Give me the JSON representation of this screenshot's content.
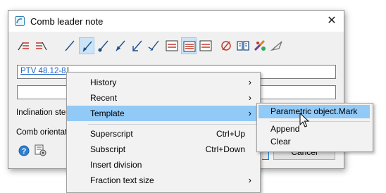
{
  "dialog": {
    "title": "Comb leader note",
    "field1_value": "PTV 48.12-8",
    "label_inclination": "Inclination step",
    "label_orientation": "Comb orientation",
    "cancel_label": "Cancel"
  },
  "toolbar": {
    "icons": [
      "leader-left-icon",
      "leader-right-icon",
      "line-plain-icon",
      "line-arrow-selected-icon",
      "line-dot-icon",
      "line-arrow-icon",
      "line-arrow-open-icon",
      "line-tick-icon",
      "align-left-icon",
      "align-center-icon",
      "align-right-icon",
      "clear-icon",
      "book-icon",
      "color-brush-icon",
      "pick-style-icon"
    ]
  },
  "context_menu": {
    "items": [
      {
        "label": "History",
        "submenu": true
      },
      {
        "label": "Recent",
        "submenu": true
      },
      {
        "label": "Template",
        "submenu": true,
        "highlighted": true
      },
      {
        "label": "Superscript",
        "shortcut": "Ctrl+Up"
      },
      {
        "label": "Subscript",
        "shortcut": "Ctrl+Down"
      },
      {
        "label": "Insert division"
      },
      {
        "label": "Fraction text size",
        "submenu": true
      }
    ]
  },
  "submenu": {
    "items": [
      {
        "label": "Parametric object.Mark",
        "highlighted": true
      },
      {
        "label": "Append"
      },
      {
        "label": "Clear"
      }
    ]
  },
  "colors": {
    "highlight": "#91c9f7",
    "link_text": "#1e64c8",
    "menu_bg": "#f2f2f2"
  }
}
